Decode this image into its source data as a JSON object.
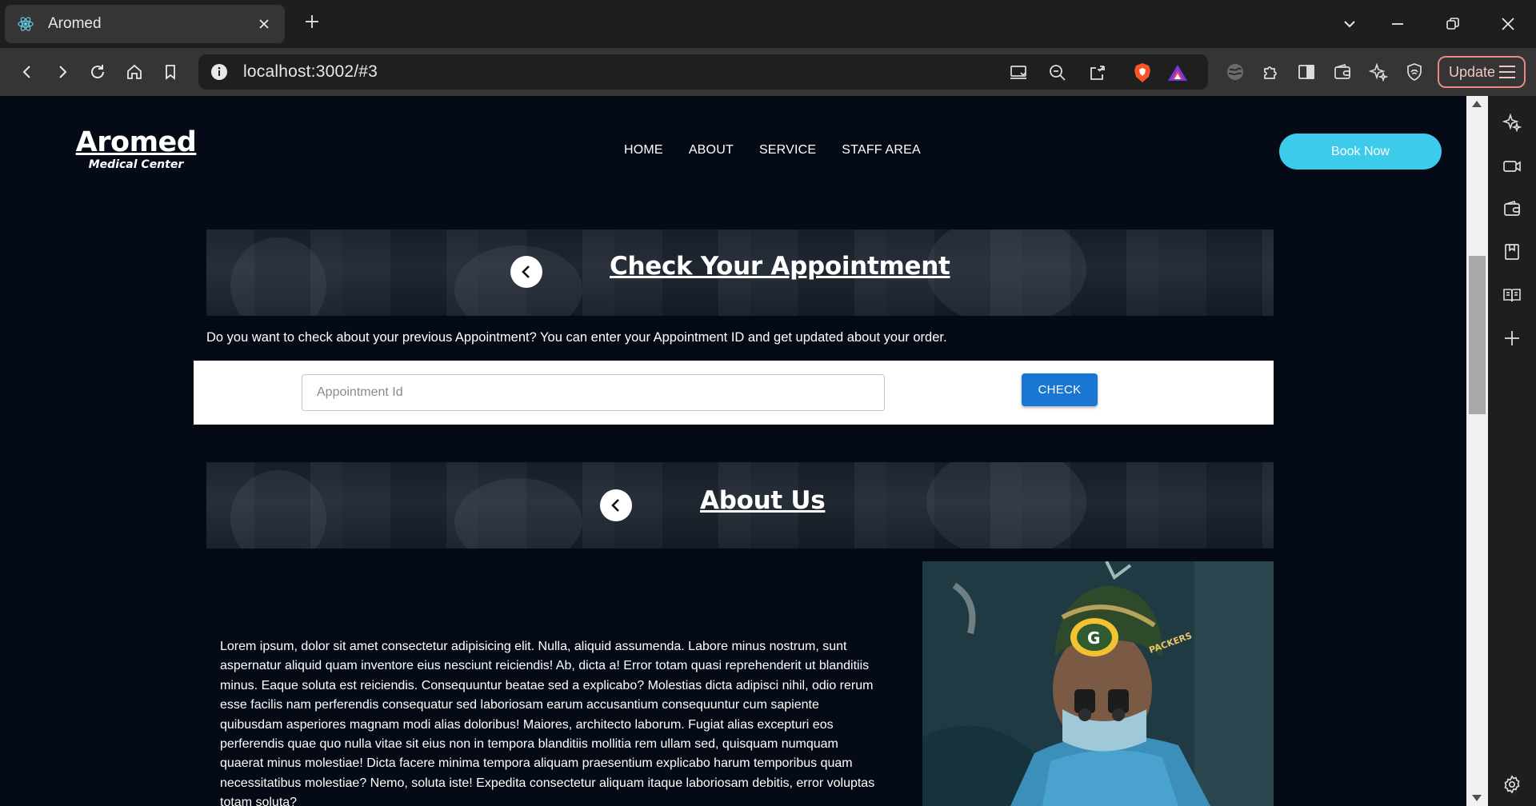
{
  "browser": {
    "tab_title": "Aromed",
    "url": "localhost:3002/#3",
    "update_label": "Update"
  },
  "site": {
    "logo_name": "Aromed",
    "logo_subtitle": "Medical Center",
    "nav": [
      "HOME",
      "ABOUT",
      "SERVICE",
      "STAFF AREA"
    ],
    "book_label": "Book Now"
  },
  "check_section": {
    "heading": "Check Your Appointment",
    "description": "Do you want to check about your previous Appointment? You can enter your Appointment ID and get updated about your order.",
    "input_placeholder": "Appointment Id",
    "input_value": "",
    "button_label": "CHECK"
  },
  "about_section": {
    "heading": "About Us",
    "body": "Lorem ipsum, dolor sit amet consectetur adipisicing elit. Nulla, aliquid assumenda. Labore minus nostrum, sunt aspernatur aliquid quam inventore eius nesciunt reiciendis! Ab, dicta a! Error totam quasi reprehenderit ut blanditiis minus. Eaque soluta est reiciendis. Consequuntur beatae sed a explicabo? Molestias dicta adipisci nihil, odio rerum esse facilis nam perferendis consequatur sed laboriosam earum accusantium consequuntur cum sapiente quibusdam asperiores magnam modi alias doloribus! Maiores, architecto laborum. Fugiat alias excepturi eos perferendis quae quo nulla vitae sit eius non in tempora blanditiis mollitia rem ullam sed, quisquam numquam quaerat minus molestiae! Dicta facere minima tempora aliquam praesentium explicabo harum temporibus quam necessitatibus molestiae? Nemo, soluta iste! Expedita consectetur aliquam itaque laboriosam debitis, error voluptas totam soluta?",
    "image_cap_text": "PACKERS"
  },
  "colors": {
    "page_bg": "#050b16",
    "accent": "#3dcbeb",
    "check_button": "#1976d2"
  }
}
